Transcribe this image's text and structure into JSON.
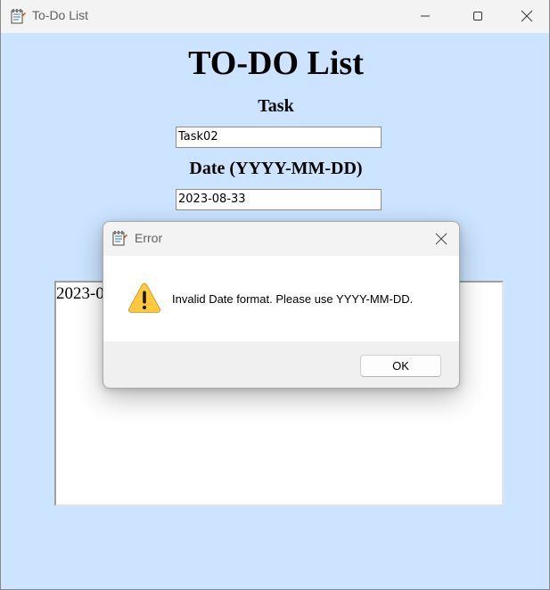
{
  "window": {
    "title": "To-Do List",
    "controls": {
      "minimize_icon": "minimize-icon",
      "maximize_icon": "maximize-icon",
      "close_icon": "close-icon"
    }
  },
  "app": {
    "heading": "TO-DO List",
    "task_label": "Task",
    "task_value": "Task02",
    "date_label": "Date (YYYY-MM-DD)",
    "date_value": "2023-08-33",
    "list_items": [
      "2023-0"
    ]
  },
  "dialog": {
    "title": "Error",
    "message": "Invalid Date format. Please use YYYY-MM-DD.",
    "ok_label": "OK",
    "icon": "warning-icon"
  },
  "colors": {
    "background": "#cce4ff",
    "titlebar": "#f3f3f3",
    "warning": "#ffc83d"
  }
}
